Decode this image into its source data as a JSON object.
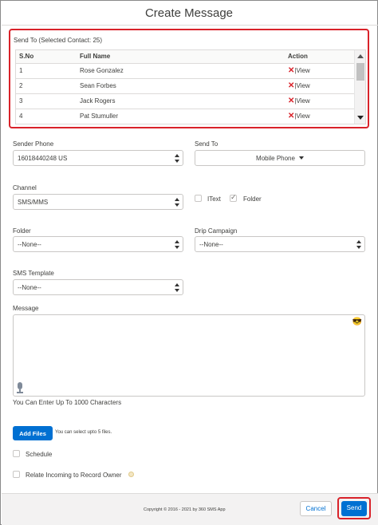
{
  "dialog": {
    "title": "Create Message"
  },
  "send_to_contacts": {
    "label": "Send To (Selected Contact: 25)",
    "columns": [
      "S.No",
      "Full Name",
      "Action"
    ],
    "rows": [
      {
        "sno": "1",
        "name": "Rose Gonzalez",
        "remove": "✕",
        "view": "|View"
      },
      {
        "sno": "2",
        "name": "Sean Forbes",
        "remove": "✕",
        "view": "|View"
      },
      {
        "sno": "3",
        "name": "Jack Rogers",
        "remove": "✕",
        "view": "|View"
      },
      {
        "sno": "4",
        "name": "Pat Stumuller",
        "remove": "✕",
        "view": "|View"
      }
    ]
  },
  "sender_phone": {
    "label": "Sender Phone",
    "value": "16018440248 US"
  },
  "send_to": {
    "label": "Send To",
    "value": "Mobile Phone"
  },
  "channel": {
    "label": "Channel",
    "value": "SMS/MMS"
  },
  "checkboxes": {
    "itext": {
      "label": "IText",
      "checked": false
    },
    "folder": {
      "label": "Folder",
      "checked": true
    }
  },
  "folder": {
    "label": "Folder",
    "value": "--None--"
  },
  "drip_campaign": {
    "label": "Drip Campaign",
    "value": "--None--"
  },
  "sms_template": {
    "label": "SMS Template",
    "value": "--None--"
  },
  "message": {
    "label": "Message",
    "value": "",
    "emoji_icon": "😎",
    "char_note": "You Can Enter Up To 1000 Characters"
  },
  "attachments": {
    "button_label": "Add Files",
    "note": "You can select upto 5 files."
  },
  "options": {
    "schedule": {
      "label": "Schedule",
      "checked": false
    },
    "relate_incoming": {
      "label": "Relate Incoming to Record Owner",
      "checked": false
    }
  },
  "footer": {
    "copyright": "Copyright © 2016 - 2021 by 360 SMS App",
    "cancel_label": "Cancel",
    "send_label": "Send"
  },
  "colors": {
    "brand_blue": "#0070d2",
    "highlight_red": "#d9222a"
  }
}
